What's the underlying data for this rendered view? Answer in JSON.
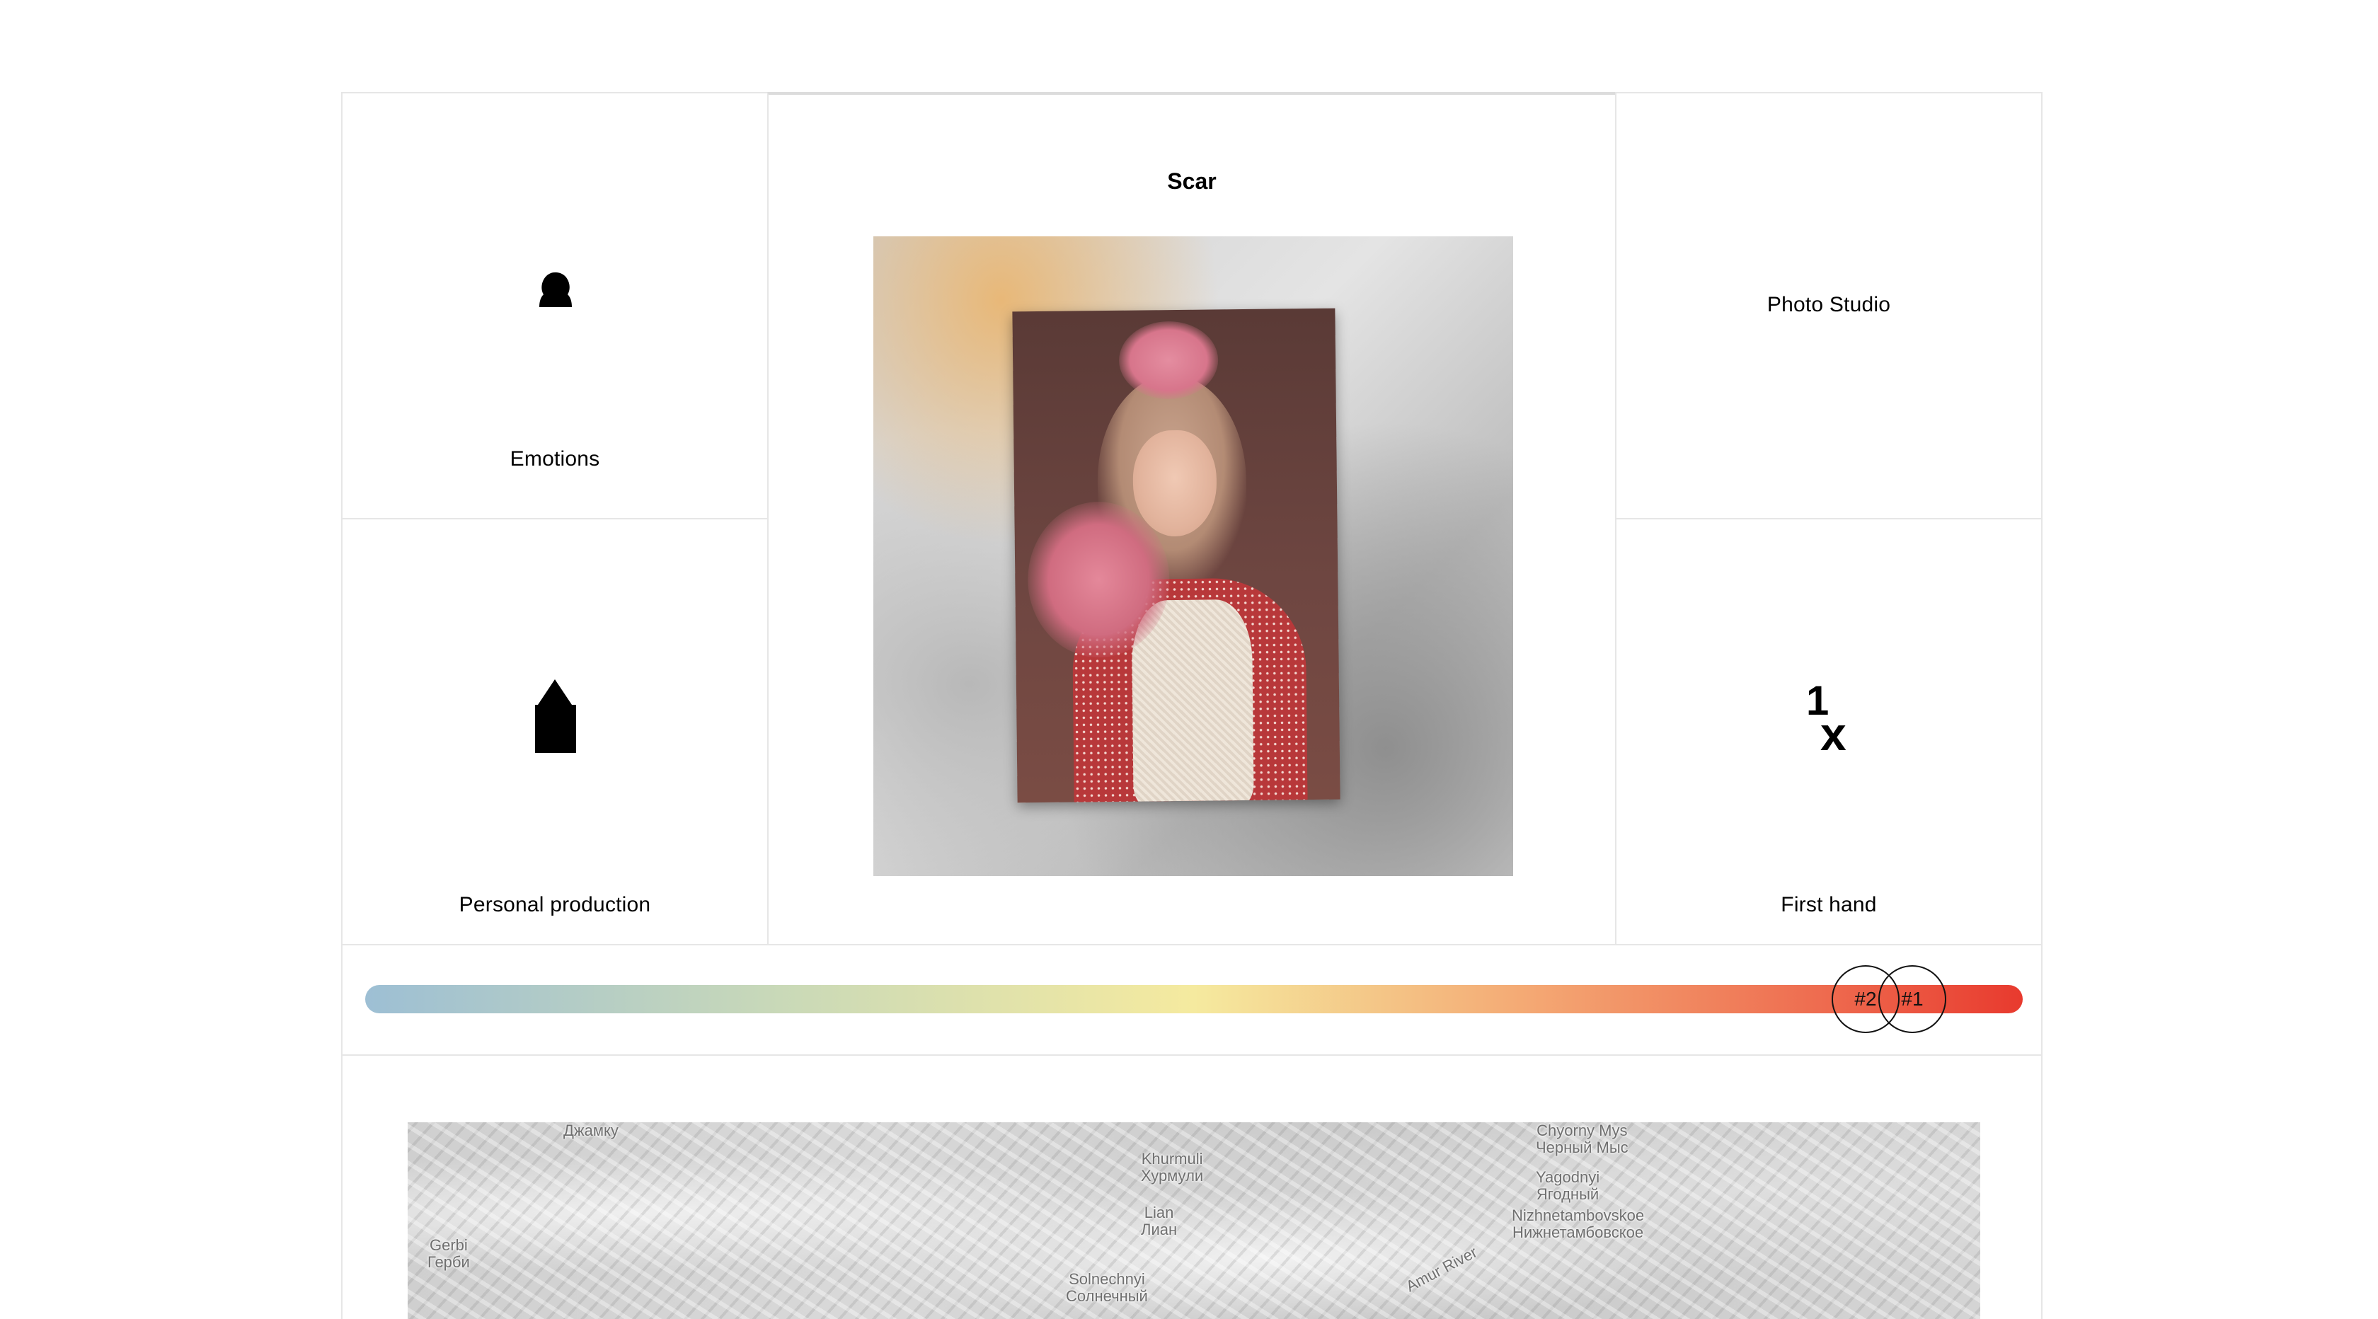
{
  "cards": {
    "emotions": {
      "label": "Emotions",
      "icon": "head-silhouette-icon"
    },
    "production": {
      "label": "Personal production",
      "icon": "house-silhouette-icon"
    },
    "studio": {
      "label": "Photo Studio"
    },
    "firsthand": {
      "label": "First hand",
      "icon": "one-x-icon",
      "icon_text_one": "1",
      "icon_text_x": "x"
    }
  },
  "center": {
    "title": "Scar",
    "photo_alt": "Vintage photo of a young girl in a red polka-dot dress with pink bows"
  },
  "scale": {
    "gradient_colors": [
      "#9dbfd4",
      "#c9d9b8",
      "#f5ea9f",
      "#f4a974",
      "#ee6b4f",
      "#e83a2e"
    ],
    "markers": [
      {
        "label": "#2"
      },
      {
        "label": "#1"
      }
    ]
  },
  "map": {
    "labels": [
      {
        "latin": "",
        "cyrillic": "Джамку"
      },
      {
        "latin": "Gerbi",
        "cyrillic": "Герби"
      },
      {
        "latin": "Khurmuli",
        "cyrillic": "Хурмули"
      },
      {
        "latin": "Lian",
        "cyrillic": "Лиан"
      },
      {
        "latin": "Solnechnyi",
        "cyrillic": "Солнечный"
      },
      {
        "latin": "Chyorny Mys",
        "cyrillic": "Черный Мыс"
      },
      {
        "latin": "Yagodnyi",
        "cyrillic": "Ягодный"
      },
      {
        "latin": "Nizhnetambovskoe",
        "cyrillic": "Нижнетамбовское"
      },
      {
        "latin": "Amur River",
        "cyrillic": ""
      }
    ],
    "pin_color": "#d84333"
  }
}
